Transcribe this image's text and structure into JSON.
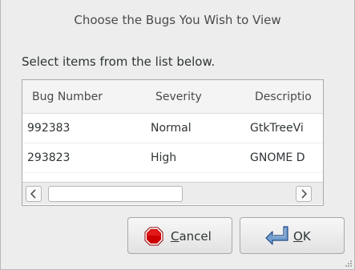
{
  "dialog": {
    "title": "Choose the Bugs You Wish to View",
    "instruction": "Select items from the list below."
  },
  "list": {
    "columns": [
      "Bug Number",
      "Severity",
      "Descriptio"
    ],
    "rows": [
      {
        "bug_number": "992383",
        "severity": "Normal",
        "description": "GtkTreeVi"
      },
      {
        "bug_number": "293823",
        "severity": "High",
        "description": "GNOME D"
      }
    ]
  },
  "buttons": {
    "cancel": {
      "mnemonic": "C",
      "rest": "ancel",
      "icon": "stop-icon"
    },
    "ok": {
      "mnemonic": "O",
      "rest": "K",
      "icon": "ok-arrow-icon"
    }
  },
  "colors": {
    "stop_red": "#cc0000",
    "ok_blue": "#3465a4"
  }
}
